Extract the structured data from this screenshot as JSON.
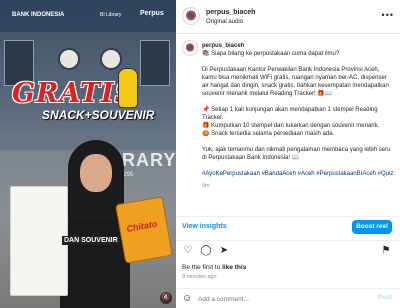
{
  "media": {
    "brand_logo": "BANK INDONESIA",
    "partner_logo_1": "BI Library",
    "partner_logo_2": "Perpus",
    "headline": "GRATIS",
    "subheadline": "SNACK+SOUVENIR",
    "wall_sign": "LIBRARY",
    "wall_phone": "1000295",
    "chips_brand": "Chitato",
    "overlay_caption": "DAN SOUVENIR",
    "mute_icon": "speaker-mute-icon"
  },
  "header": {
    "username": "perpus_biaceh",
    "audio": "Original audio",
    "more_icon": "more-horizontal-icon"
  },
  "caption": {
    "username": "perpus_biaceh",
    "line1": "📚 Siapa bilang ke perpustakaan cuma dapat ilmu?",
    "para2": "Di Perpustakaan Kantor Perwakilan Bank Indonesia Provinsi Aceh, kamu bisa menikmati WiFi gratis, ruangan nyaman ber-AC, dispenser air hangat dan dingin, snack gratis, bahkan kesempatan mendapatkan souvenir menarik melalui Reading Tracker! 🎁📖",
    "para3": "📌 Setiap 1 kali kunjungan akan mendapatkan 1 stempel Reading Tracker.\n🎁 Kumpulkan 10 stempel dan tukarkan dengan souvenir menarik.\n🍪 Snack tersedia selama persediaan masih ada.",
    "para4": "Yuk, ajak temanmu dan nikmati pengalaman membaca yang lebih seru di Perpustakaan Bank Indonesia! 📖",
    "tags": "#AyoKePerpustakaan #BandaAceh #Aceh #PerpustakaanBIAceh #Quiz",
    "timestamp": "9m"
  },
  "insights": {
    "link": "View insights",
    "boost": "Boost reel"
  },
  "actions": {
    "like_icon": "heart-icon",
    "comment_icon": "comment-icon",
    "share_icon": "send-icon",
    "save_icon": "bookmark-icon"
  },
  "likes": {
    "prefix": "Be the first to ",
    "bold": "like this"
  },
  "posted": "9 minutes ago",
  "comment": {
    "emoji_icon": "emoji-smile-icon",
    "placeholder": "Add a comment...",
    "post_label": "Post"
  }
}
